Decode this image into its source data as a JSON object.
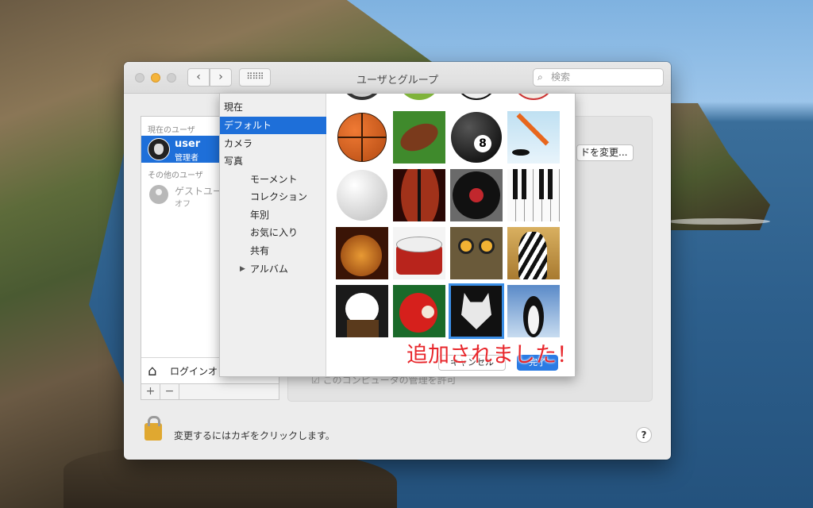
{
  "window": {
    "title": "ユーザとグループ"
  },
  "toolbar": {
    "back_glyph": "‹",
    "forward_glyph": "›",
    "grid_glyph": "⠿⠿⠿",
    "search_placeholder": "検索"
  },
  "sidebar": {
    "current_user_header": "現在のユーザ",
    "current_user": {
      "name": "user",
      "role": "管理者"
    },
    "other_users_header": "その他のユーザ",
    "guest_user": {
      "name": "ゲストユー",
      "status": "オフ"
    },
    "login_options": "ログインオ",
    "add": "+",
    "remove": "−"
  },
  "panel": {
    "change_password_button": "ドを変更...",
    "admin_checkbox": "このコンピュータの管理を許可"
  },
  "footer": {
    "lock_text": "変更するにはカギをクリックします。",
    "help": "?"
  },
  "picker": {
    "sources": [
      {
        "label": "現在",
        "selected": false,
        "sub": false
      },
      {
        "label": "デフォルト",
        "selected": true,
        "sub": false
      },
      {
        "label": "カメラ",
        "selected": false,
        "sub": false
      },
      {
        "label": "写真",
        "selected": false,
        "sub": false
      },
      {
        "label": "モーメント",
        "selected": false,
        "sub": true
      },
      {
        "label": "コレクション",
        "selected": false,
        "sub": true
      },
      {
        "label": "年別",
        "selected": false,
        "sub": true
      },
      {
        "label": "お気に入り",
        "selected": false,
        "sub": true
      },
      {
        "label": "共有",
        "selected": false,
        "sub": true
      },
      {
        "label": "アルバム",
        "selected": false,
        "sub": true,
        "disclosure": "▶"
      }
    ],
    "images": [
      "basketball",
      "football",
      "8-ball",
      "hockey",
      "golf-ball",
      "violin",
      "vinyl-record",
      "piano",
      "guitar",
      "drum",
      "owl",
      "zebra",
      "eagle",
      "parrot",
      "wolf",
      "penguin"
    ],
    "selected_image": "wolf",
    "cancel": "キャンセル",
    "ok": "完了"
  },
  "annotation": "追加されました！",
  "colors": {
    "accent": "#1e6fd9",
    "annotation": "#e8262b"
  }
}
